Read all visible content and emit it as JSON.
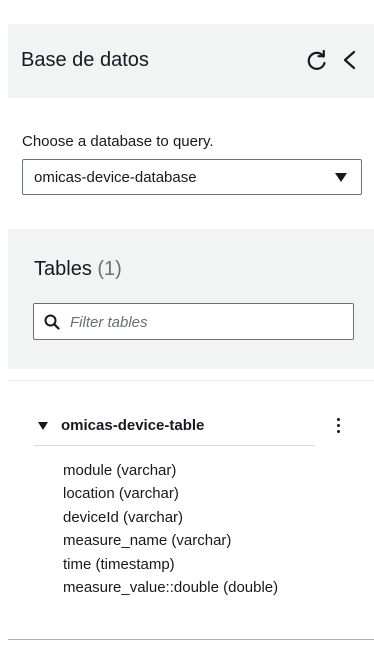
{
  "header": {
    "title": "Base de datos"
  },
  "database": {
    "label": "Choose a database to query.",
    "selected": "omicas-device-database"
  },
  "tables": {
    "title": "Tables",
    "count": "(1)",
    "filter_placeholder": "Filter tables",
    "filter_value": ""
  },
  "table": {
    "name": "omicas-device-table",
    "columns": [
      "module (varchar)",
      "location (varchar)",
      "deviceId (varchar)",
      "measure_name (varchar)",
      "time (timestamp)",
      "measure_value::double (double)"
    ]
  },
  "icons": {
    "refresh": "refresh-icon",
    "collapse": "chevron-left-icon",
    "dropdown": "caret-down-icon",
    "search": "search-icon",
    "expand": "caret-down-icon",
    "more": "more-vertical-icon"
  }
}
